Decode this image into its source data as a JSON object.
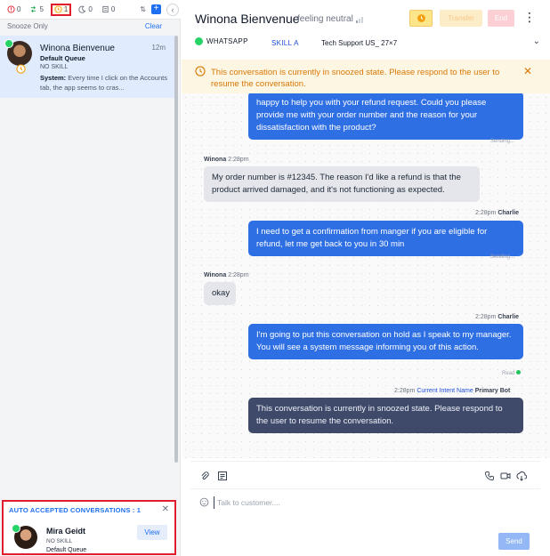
{
  "topbar": {
    "counters": [
      {
        "name": "alert",
        "icon": "alert-circle-icon",
        "count": "0",
        "color": "#e11d2e"
      },
      {
        "name": "transfer",
        "icon": "transfer-icon",
        "count": "5",
        "color": "#16a34a"
      },
      {
        "name": "snoozed",
        "icon": "clock-icon",
        "count": "1",
        "color": "#f59e0b",
        "active": true
      },
      {
        "name": "night",
        "icon": "moon-icon",
        "count": "0",
        "color": "#6b7280"
      },
      {
        "name": "notes",
        "icon": "note-icon",
        "count": "0",
        "color": "#6b7280"
      }
    ],
    "sort_label": "⇅"
  },
  "filter": {
    "label": "Snooze Only",
    "clear_label": "Clear"
  },
  "conversation": {
    "name": "Winona Bienvenue",
    "time": "12m",
    "queue": "Default Queue",
    "skill": "NO SKILL",
    "preview_label": "System:",
    "preview_text": " Every time I click on the Accounts tab, the app seems to cras..."
  },
  "auto_accepted": {
    "title": "AUTO ACCEPTED CONVERSATIONS : 1",
    "name": "Mira Geidt",
    "skill": "NO SKILL",
    "queue": "Default Queue",
    "view_label": "View"
  },
  "header": {
    "name": "Winona Bienvenue",
    "mood": "feeling neutral",
    "transfer_label": "Transfer",
    "end_label": "End",
    "more_label": "⋮"
  },
  "channel": {
    "type": "WHATSAPP",
    "skill": "SKILL A",
    "queue": "Tech Support US_ 27×7"
  },
  "banner": {
    "text": "This conversation is currently in snoozed state. Please respond to the user to resume the conversation."
  },
  "messages": {
    "m1_text": "happy to help you with your refund request. Could you please provide me with your order number and the reason for your dissatisfaction with the product?",
    "m1_status": "Sending...",
    "m2_sender": "Winona",
    "m2_time": "2:28pm",
    "m2_text": "My order number is #12345. The reason I'd like a refund is that the product arrived damaged, and it's not functioning as expected.",
    "m3_time": "2:28pm",
    "m3_sender": "Charlie",
    "m3_text": "I need to get a confirmation from manger if you are eligible for refund, let me get back to you in 30 min",
    "m3_status": "Sending...",
    "m4_sender": "Winona",
    "m4_time": "2:28pm",
    "m4_text": "okay",
    "m5_time": "2:28pm",
    "m5_sender": "Charlie",
    "m5_text": "I'm going to put this conversation on hold as I speak to my manager. You will see a system message informing you of this action.",
    "m5_status": "Read",
    "m6_time": "2:28pm",
    "m6_intent": "Current Intent Name",
    "m6_sender": "Primary Bot",
    "m6_text": "This conversation is currently in snoozed state. Please respond to the user to resume the conversation."
  },
  "composer": {
    "placeholder": "Talk to customer....",
    "send_label": "Send"
  },
  "colors": {
    "accent": "#1d6ff2",
    "agent_bubble": "#2f6fe4",
    "bot_bubble": "#3f4a6b",
    "highlight": "#e11d2e",
    "banner_text": "#d97706"
  }
}
